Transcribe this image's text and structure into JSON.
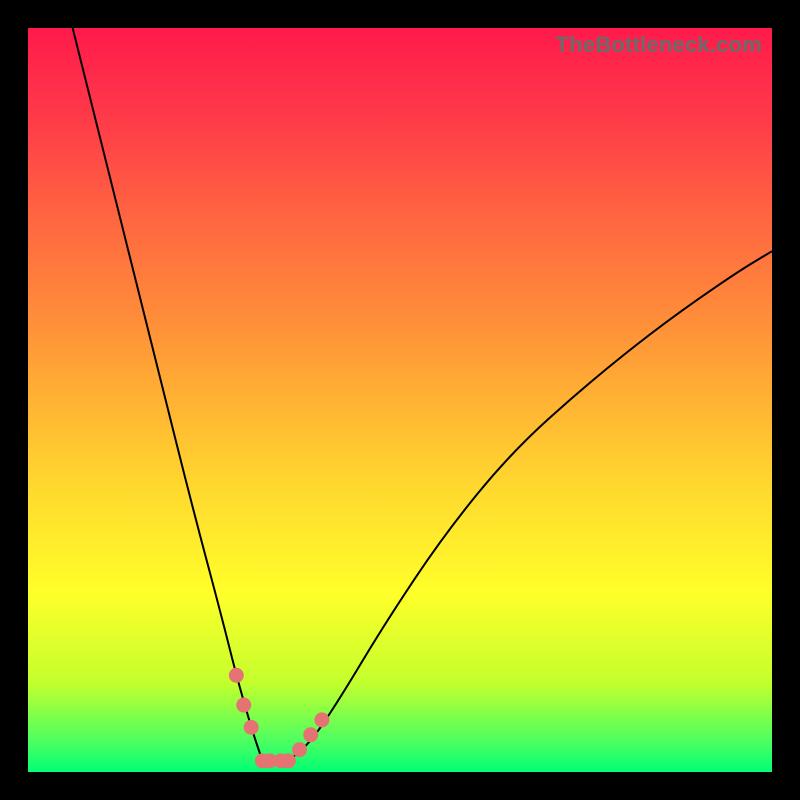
{
  "watermark": "TheBottleneck.com",
  "colors": {
    "frame": "#000000",
    "gradient_top": "#ff1a4b",
    "gradient_mid": "#ffff2a",
    "gradient_bottom": "#00ff74",
    "curve": "#000000",
    "marker": "#e57373"
  },
  "chart_data": {
    "type": "line",
    "title": "",
    "xlabel": "",
    "ylabel": "",
    "xlim": [
      0,
      100
    ],
    "ylim": [
      0,
      100
    ],
    "description": "Bottleneck-style V curve. x represents a relative hardware/performance index (0-100). y represents percent bottleneck (0 at bottom = best match, 100 at top = severe bottleneck). Two branches descend to a common minimum, forming a V. Left branch is steeper (starts off-chart above 100% at x≈6), right branch rises to ≈70% at x=100.",
    "series": [
      {
        "name": "left-branch",
        "x": [
          6,
          10,
          14,
          18,
          22,
          26,
          28,
          30,
          31.5
        ],
        "values": [
          100,
          84,
          68,
          52,
          36,
          21,
          13,
          6,
          1.5
        ]
      },
      {
        "name": "right-branch",
        "x": [
          35,
          38,
          42,
          48,
          56,
          65,
          75,
          85,
          95,
          100
        ],
        "values": [
          1.5,
          4,
          10,
          20,
          32,
          43,
          52,
          60,
          67,
          70
        ]
      }
    ],
    "plateau": {
      "name": "best-match-zone",
      "x": [
        31.5,
        35
      ],
      "value": 1.5
    },
    "markers": [
      {
        "branch": "left",
        "x": 28.0,
        "y": 13.0
      },
      {
        "branch": "left",
        "x": 29.0,
        "y": 9.0
      },
      {
        "branch": "left",
        "x": 30.0,
        "y": 6.0
      },
      {
        "branch": "plateau",
        "x": 31.5,
        "y": 1.5
      },
      {
        "branch": "plateau",
        "x": 32.5,
        "y": 1.5
      },
      {
        "branch": "plateau",
        "x": 34.0,
        "y": 1.5
      },
      {
        "branch": "plateau",
        "x": 35.0,
        "y": 1.5
      },
      {
        "branch": "right",
        "x": 36.5,
        "y": 3.0
      },
      {
        "branch": "right",
        "x": 38.0,
        "y": 5.0
      },
      {
        "branch": "right",
        "x": 39.5,
        "y": 7.0
      }
    ]
  }
}
